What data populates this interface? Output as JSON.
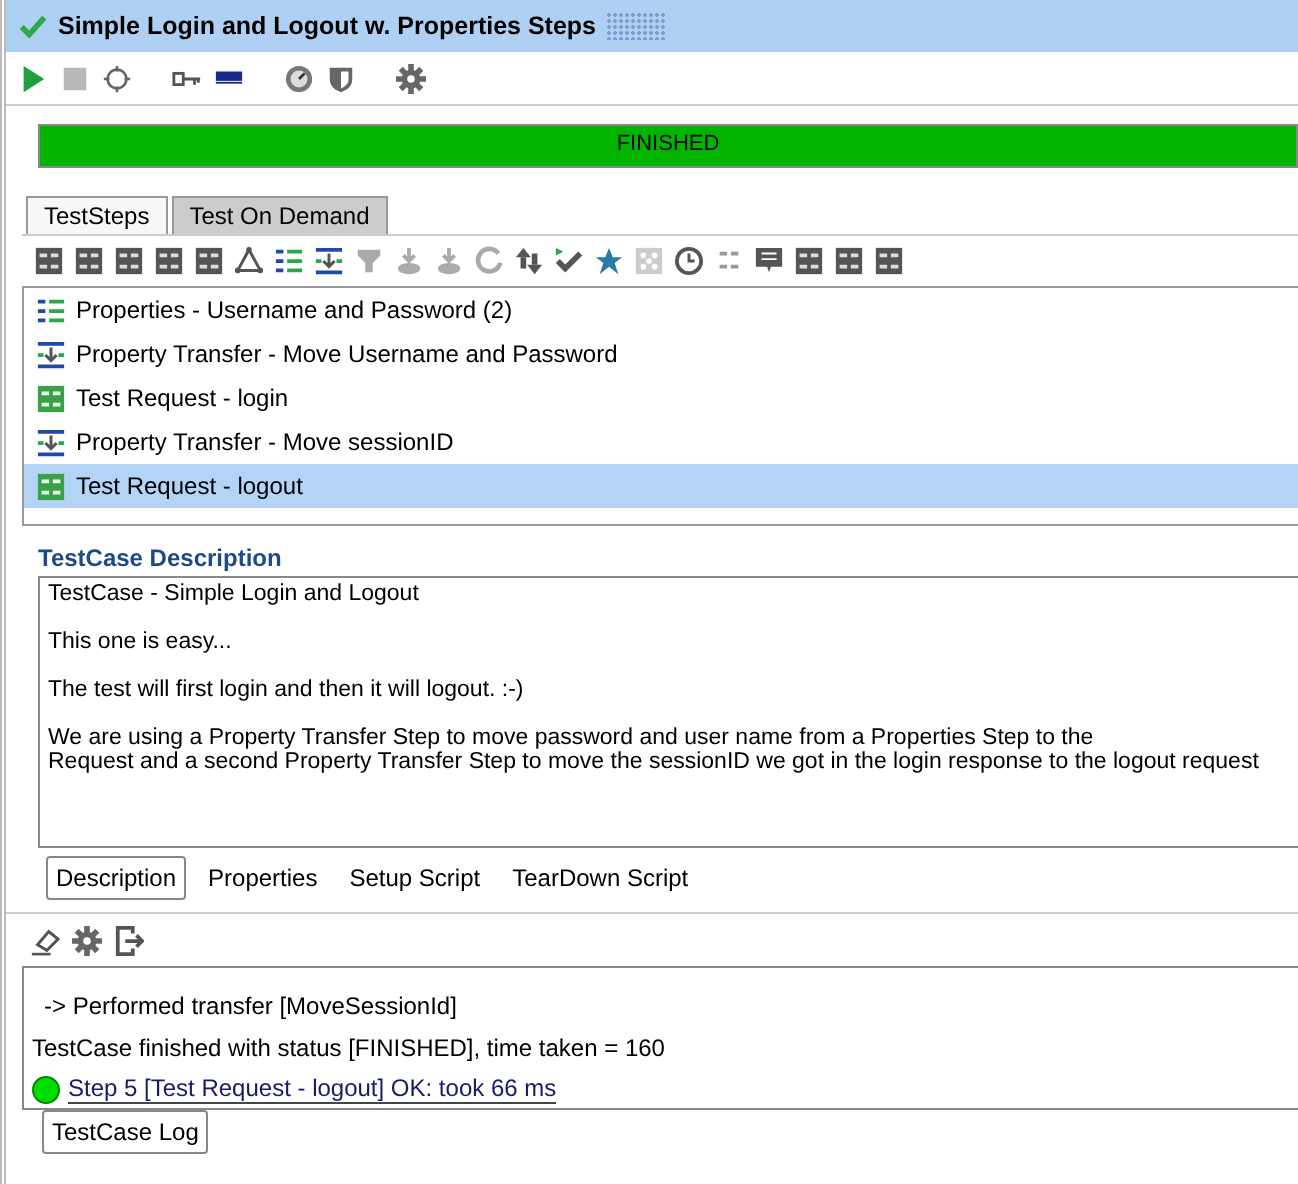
{
  "window": {
    "title": "Simple Login and Logout w. Properties Steps",
    "passed": true
  },
  "progress": {
    "level": 1,
    "label": "FINISHED"
  },
  "tabs": [
    {
      "label": "TestSteps",
      "selected": true
    },
    {
      "label": "Test On Demand",
      "selected": false
    }
  ],
  "steps": [
    {
      "kind": "properties",
      "label": "Properties - Username and Password (2)",
      "selected": false
    },
    {
      "kind": "transfer",
      "label": "Property Transfer - Move Username and Password",
      "selected": false
    },
    {
      "kind": "request",
      "label": "Test Request - login",
      "selected": false
    },
    {
      "kind": "transfer",
      "label": "Property Transfer - Move sessionID",
      "selected": false
    },
    {
      "kind": "request",
      "label": "Test Request - logout",
      "selected": true
    }
  ],
  "description": {
    "heading": "TestCase Description",
    "paragraphs": [
      "TestCase - Simple Login and Logout",
      "This one is easy...",
      "The test will first login and then it will logout. :-)",
      "We are using a Property Transfer Step to move password and user name from a Properties Step to the",
      "Request and a second Property Transfer Step to move the sessionID we got in the login response to the logout request"
    ]
  },
  "description_tabs": [
    {
      "label": "Description",
      "selected": true
    },
    {
      "label": "Properties",
      "selected": false
    },
    {
      "label": "Setup Script",
      "selected": false
    },
    {
      "label": "TearDown Script",
      "selected": false
    }
  ],
  "log": [
    {
      "kind": "text",
      "text": "-> Performed transfer [MoveSessionId]"
    },
    {
      "kind": "summary",
      "text": "TestCase finished with status [FINISHED], time taken = 160"
    },
    {
      "kind": "step",
      "text": "Step 5 [Test Request - logout] OK: took 66 ms"
    }
  ],
  "log_tabs": [
    {
      "label": "TestCase Log",
      "selected": true
    }
  ]
}
